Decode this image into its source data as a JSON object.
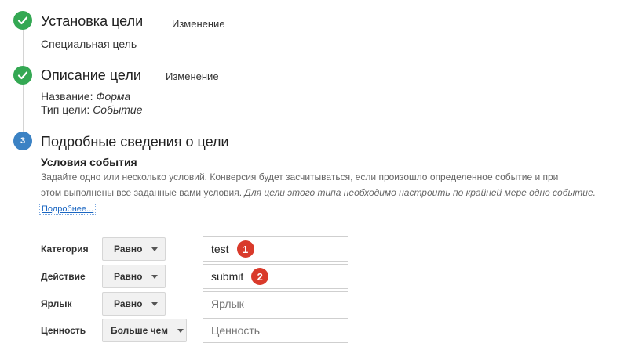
{
  "steps": [
    {
      "title": "Установка цели",
      "edit_label": "Изменение",
      "detail": "Специальная цель"
    },
    {
      "title": "Описание цели",
      "edit_label": "Изменение",
      "name_label": "Название:",
      "name_value": "Форма",
      "type_label": "Тип цели:",
      "type_value": "Событие"
    },
    {
      "number": "3",
      "title": "Подробные сведения о цели"
    }
  ],
  "conditions": {
    "title": "Условия события",
    "description_line1": "Задайте одно или несколько условий. Конверсия будет засчитываться, если произошло определенное событие и при",
    "description_line2": "этом выполнены все заданные вами условия.",
    "description_note": "Для цели этого типа необходимо настроить по крайней мере одно событие.",
    "more_link": "Подробнее..."
  },
  "rows": [
    {
      "label": "Категория",
      "operator": "Равно",
      "value": "test",
      "placeholder": "",
      "badge": "1"
    },
    {
      "label": "Действие",
      "operator": "Равно",
      "value": "submit",
      "placeholder": "",
      "badge": "2"
    },
    {
      "label": "Ярлык",
      "operator": "Равно",
      "value": "",
      "placeholder": "Ярлык"
    },
    {
      "label": "Ценность",
      "operator": "Больше чем",
      "value": "",
      "placeholder": "Ценность"
    }
  ],
  "colors": {
    "check": "#34a853",
    "step_number": "#3b82c4",
    "badge": "#d93a2b",
    "link": "#1a66c2"
  },
  "icons": [
    "check-icon",
    "caret-down-icon"
  ]
}
